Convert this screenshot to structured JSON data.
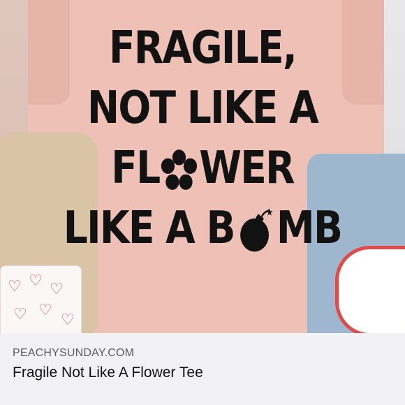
{
  "image": {
    "lines": [
      "FRAGILE,",
      "NOT LIKE A",
      "FL",
      "WER",
      "LIKE A B",
      "MB"
    ],
    "icons": [
      "flower-icon",
      "bomb-icon"
    ]
  },
  "caption": {
    "site": "PEACHYSUNDAY.COM",
    "product": "Fragile Not Like A Flower Tee"
  }
}
